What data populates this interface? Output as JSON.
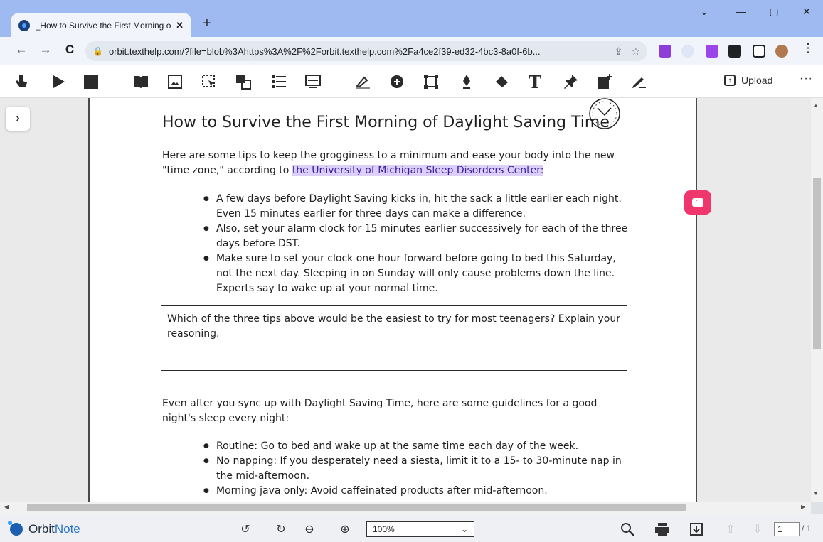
{
  "browser": {
    "tab_title": "_How to Survive the First Morning of Daylight Saving Time",
    "tab_close": "✕",
    "new_tab": "+",
    "url": "orbit.texthelp.com/?file=blob%3Ahttps%3A%2F%2Forbit.texthelp.com%2Fa4ce2f39-ed32-4bc3-8a0f-6b...",
    "window_controls": [
      "⌄",
      "—",
      "▢",
      "✕"
    ]
  },
  "toolbar": {
    "upload_label": "Upload",
    "more_label": "···"
  },
  "document": {
    "title": "How to Survive the First Morning of Daylight Saving Time",
    "intro_before": "Here are some tips to keep the grogginess to a minimum and ease your body into the new \"time zone,\" according to ",
    "intro_highlight": "the University of Michigan Sleep Disorders Center",
    "intro_after": ":",
    "tips": [
      "A few days before Daylight Saving kicks in, hit the sack a little earlier each night. Even 15 minutes earlier for three days can make a difference.",
      "Also, set your alarm clock for 15 minutes earlier successively for each of the three days before DST.",
      "Make sure to set your clock one hour forward before going to bed this Saturday, not the next day. Sleeping in on Sunday will only cause problems down the line. Experts say to wake up at your normal time."
    ],
    "question": "Which of the three tips above would be the easiest to try for most teenagers?  Explain your reasoning.",
    "guidelines_intro": "Even after you sync up with Daylight Saving Time, here are some guidelines for a good night's sleep every night:",
    "guidelines": [
      "Routine: Go to bed and wake up at the same time each day of the week.",
      "No napping: If you desperately need a siesta, limit it to a 15- to 30-minute nap in the mid-afternoon.",
      "Morning java only: Avoid caffeinated products after mid-afternoon."
    ]
  },
  "bottom": {
    "brand_part1": "Orbit",
    "brand_part2": "Note",
    "zoom_value": "100%",
    "page_current": "1",
    "page_total": "/ 1"
  },
  "colors": {
    "highlight": "#dcd0fb",
    "comment_button": "#f0376d",
    "tabstrip": "#9fbaf0"
  }
}
